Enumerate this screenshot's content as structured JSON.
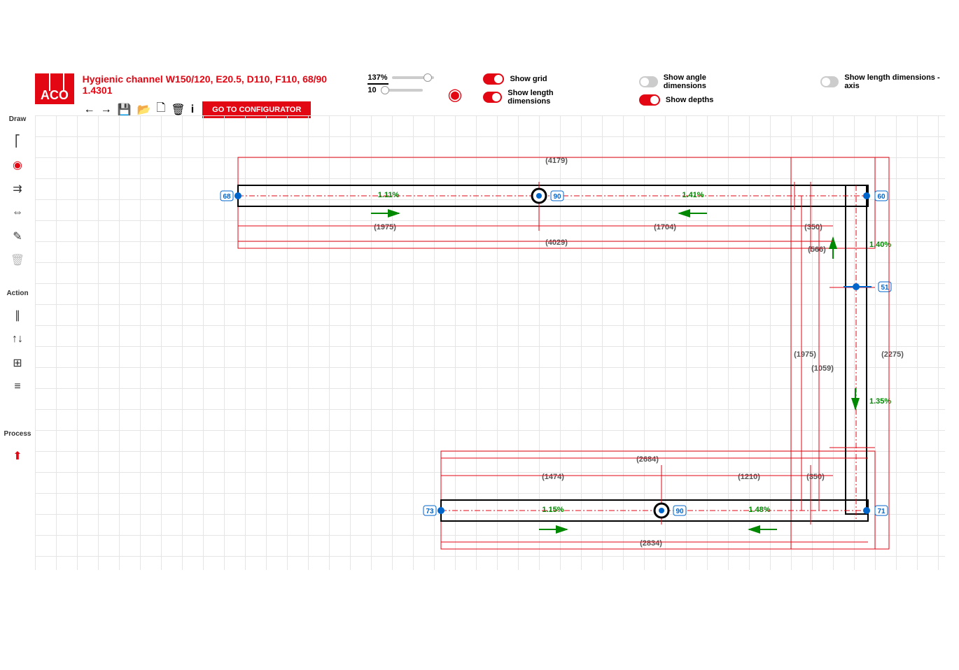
{
  "header": {
    "logo_text": "ACO",
    "title": "Hygienic channel W150/120, E20.5, D110, F110, 68/90 1.4301",
    "goto_btn": "GO TO CONFIGURATOR",
    "zoom_pct": "137%",
    "zoom_step": "10"
  },
  "toggles": {
    "show_grid": "Show grid",
    "show_length_dims": "Show length dimensions",
    "show_angle_dims": "Show angle dimensions",
    "show_depths": "Show depths",
    "show_length_axis": "Show length dimensions - axis"
  },
  "toolbar": {
    "draw_hdr": "Draw",
    "action_hdr": "Action",
    "process_hdr": "Process"
  },
  "dims": {
    "d4179": "(4179)",
    "d1975a": "(1975)",
    "d1704": "(1704)",
    "d350a": "(350)",
    "d4029": "(4029)",
    "d566": "(566)",
    "d1975b": "(1975)",
    "d1059": "(1059)",
    "d2275": "(2275)",
    "d2684": "(2684)",
    "d1474": "(1474)",
    "d1210": "(1210)",
    "d350b": "(350)",
    "d2834": "(2834)"
  },
  "slopes": {
    "s111": "1.11%",
    "s141": "1.41%",
    "s140": "1.40%",
    "s135": "1.35%",
    "s115": "1.15%",
    "s148": "1.48%"
  },
  "depths": {
    "n68": "68",
    "n90a": "90",
    "n60": "60",
    "n51": "51",
    "n73": "73",
    "n90b": "90",
    "n71": "71"
  }
}
